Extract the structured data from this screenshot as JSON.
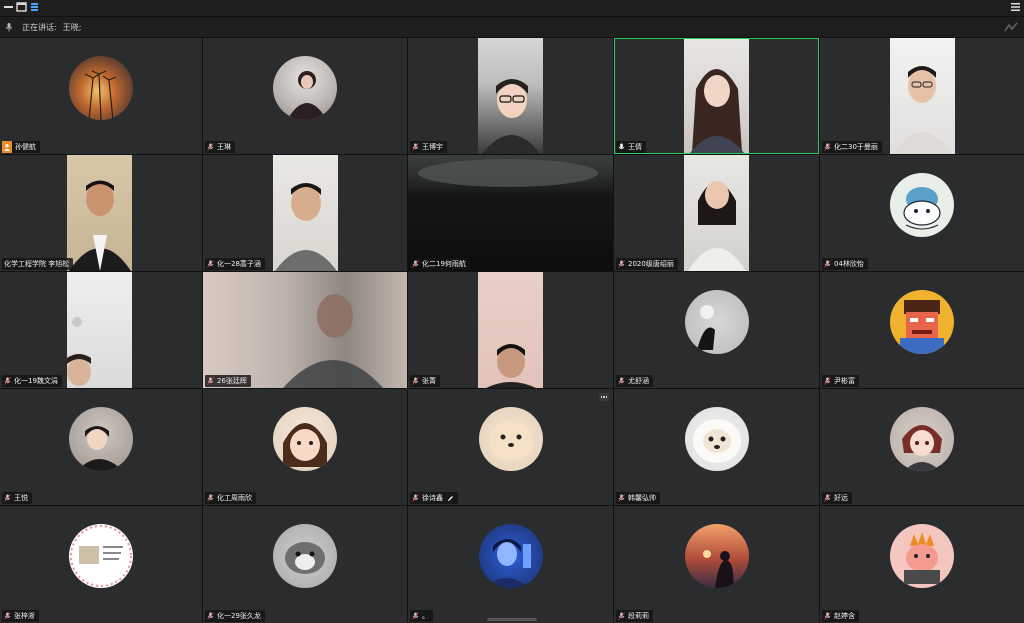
{
  "window": {
    "speaking_label": "正在讲话:",
    "speaking_name": "王晓;"
  },
  "colors": {
    "active_border": "#2ecc5a",
    "host_badge": "#f08a24",
    "tile_bg": "#2b2c2e"
  },
  "participants": [
    {
      "name": "孙健航",
      "host": true
    },
    {
      "name": "王琳"
    },
    {
      "name": "王博宇"
    },
    {
      "name": "王倩",
      "active": true
    },
    {
      "name": "化二30于曼丽"
    },
    {
      "name": "化学工程学院 李旭松"
    },
    {
      "name": "化一28蒿子涵"
    },
    {
      "name": "化二19何雨航"
    },
    {
      "name": "2020级唐绍丽"
    },
    {
      "name": "04林欣怡"
    },
    {
      "name": "化一19魏文涓"
    },
    {
      "name": "26张廷辉"
    },
    {
      "name": "张菁"
    },
    {
      "name": "尤舒涵"
    },
    {
      "name": "尹彬富"
    },
    {
      "name": "王悦"
    },
    {
      "name": "化工周雨欣"
    },
    {
      "name": "徐诗鑫",
      "editing": true
    },
    {
      "name": "韩馨弘帅"
    },
    {
      "name": "好远"
    },
    {
      "name": "张梓淅"
    },
    {
      "name": "化一29张久龙"
    },
    {
      "name": "。"
    },
    {
      "name": "段莉莉"
    },
    {
      "name": "赵婷含"
    }
  ]
}
